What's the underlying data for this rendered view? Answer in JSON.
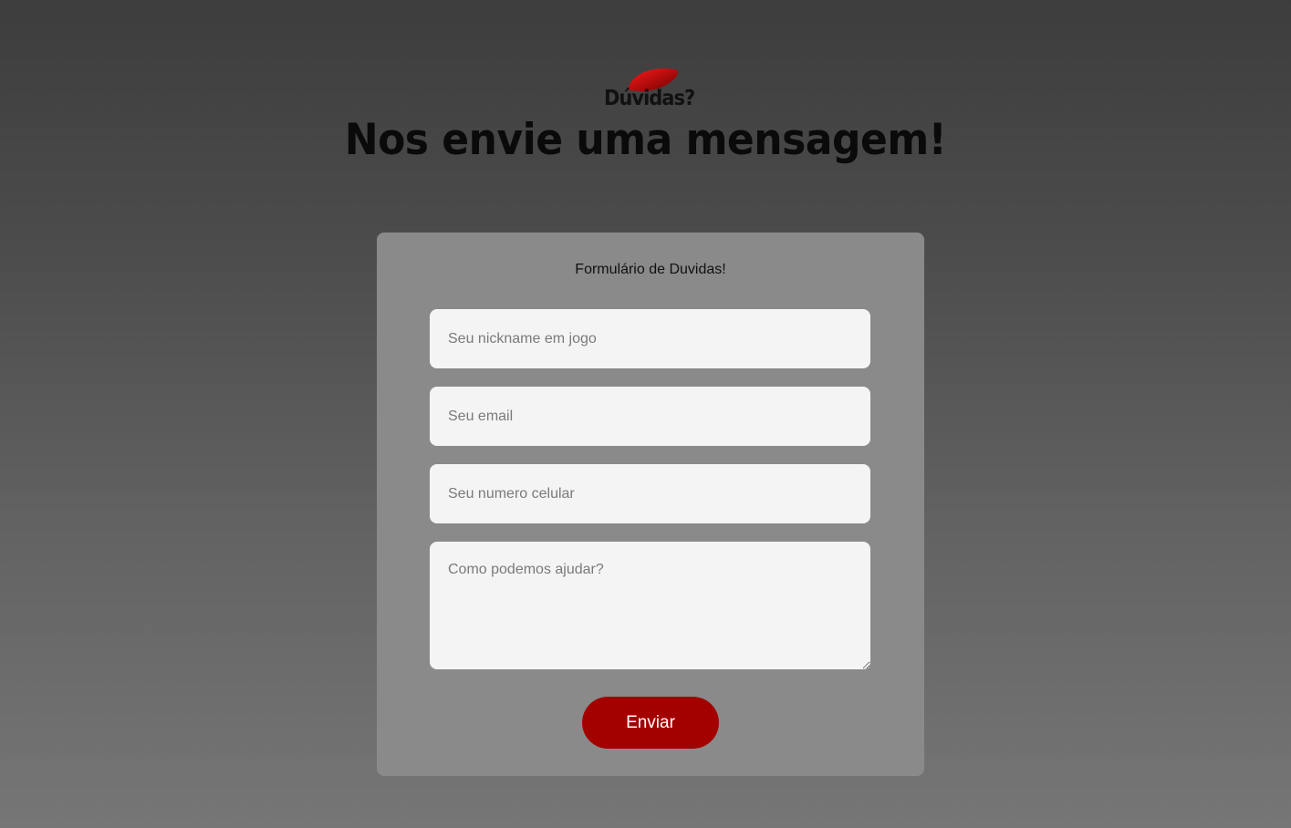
{
  "logo": {
    "text": "Dúvidas?"
  },
  "header": {
    "title": "Nos envie uma mensagem!"
  },
  "form": {
    "title": "Formulário de Duvidas!",
    "fields": [
      {
        "placeholder": "Seu nickname em jogo",
        "value": ""
      },
      {
        "placeholder": "Seu email",
        "value": ""
      },
      {
        "placeholder": "Seu numero celular",
        "value": ""
      },
      {
        "placeholder": "Como podemos ajudar?",
        "value": ""
      }
    ],
    "submit_label": "Enviar"
  },
  "colors": {
    "accent": "#a30000",
    "card_background": "#8a8a8a",
    "field_background": "#f4f4f4"
  },
  "icons": {
    "logo_mark": "red-lips-icon"
  }
}
